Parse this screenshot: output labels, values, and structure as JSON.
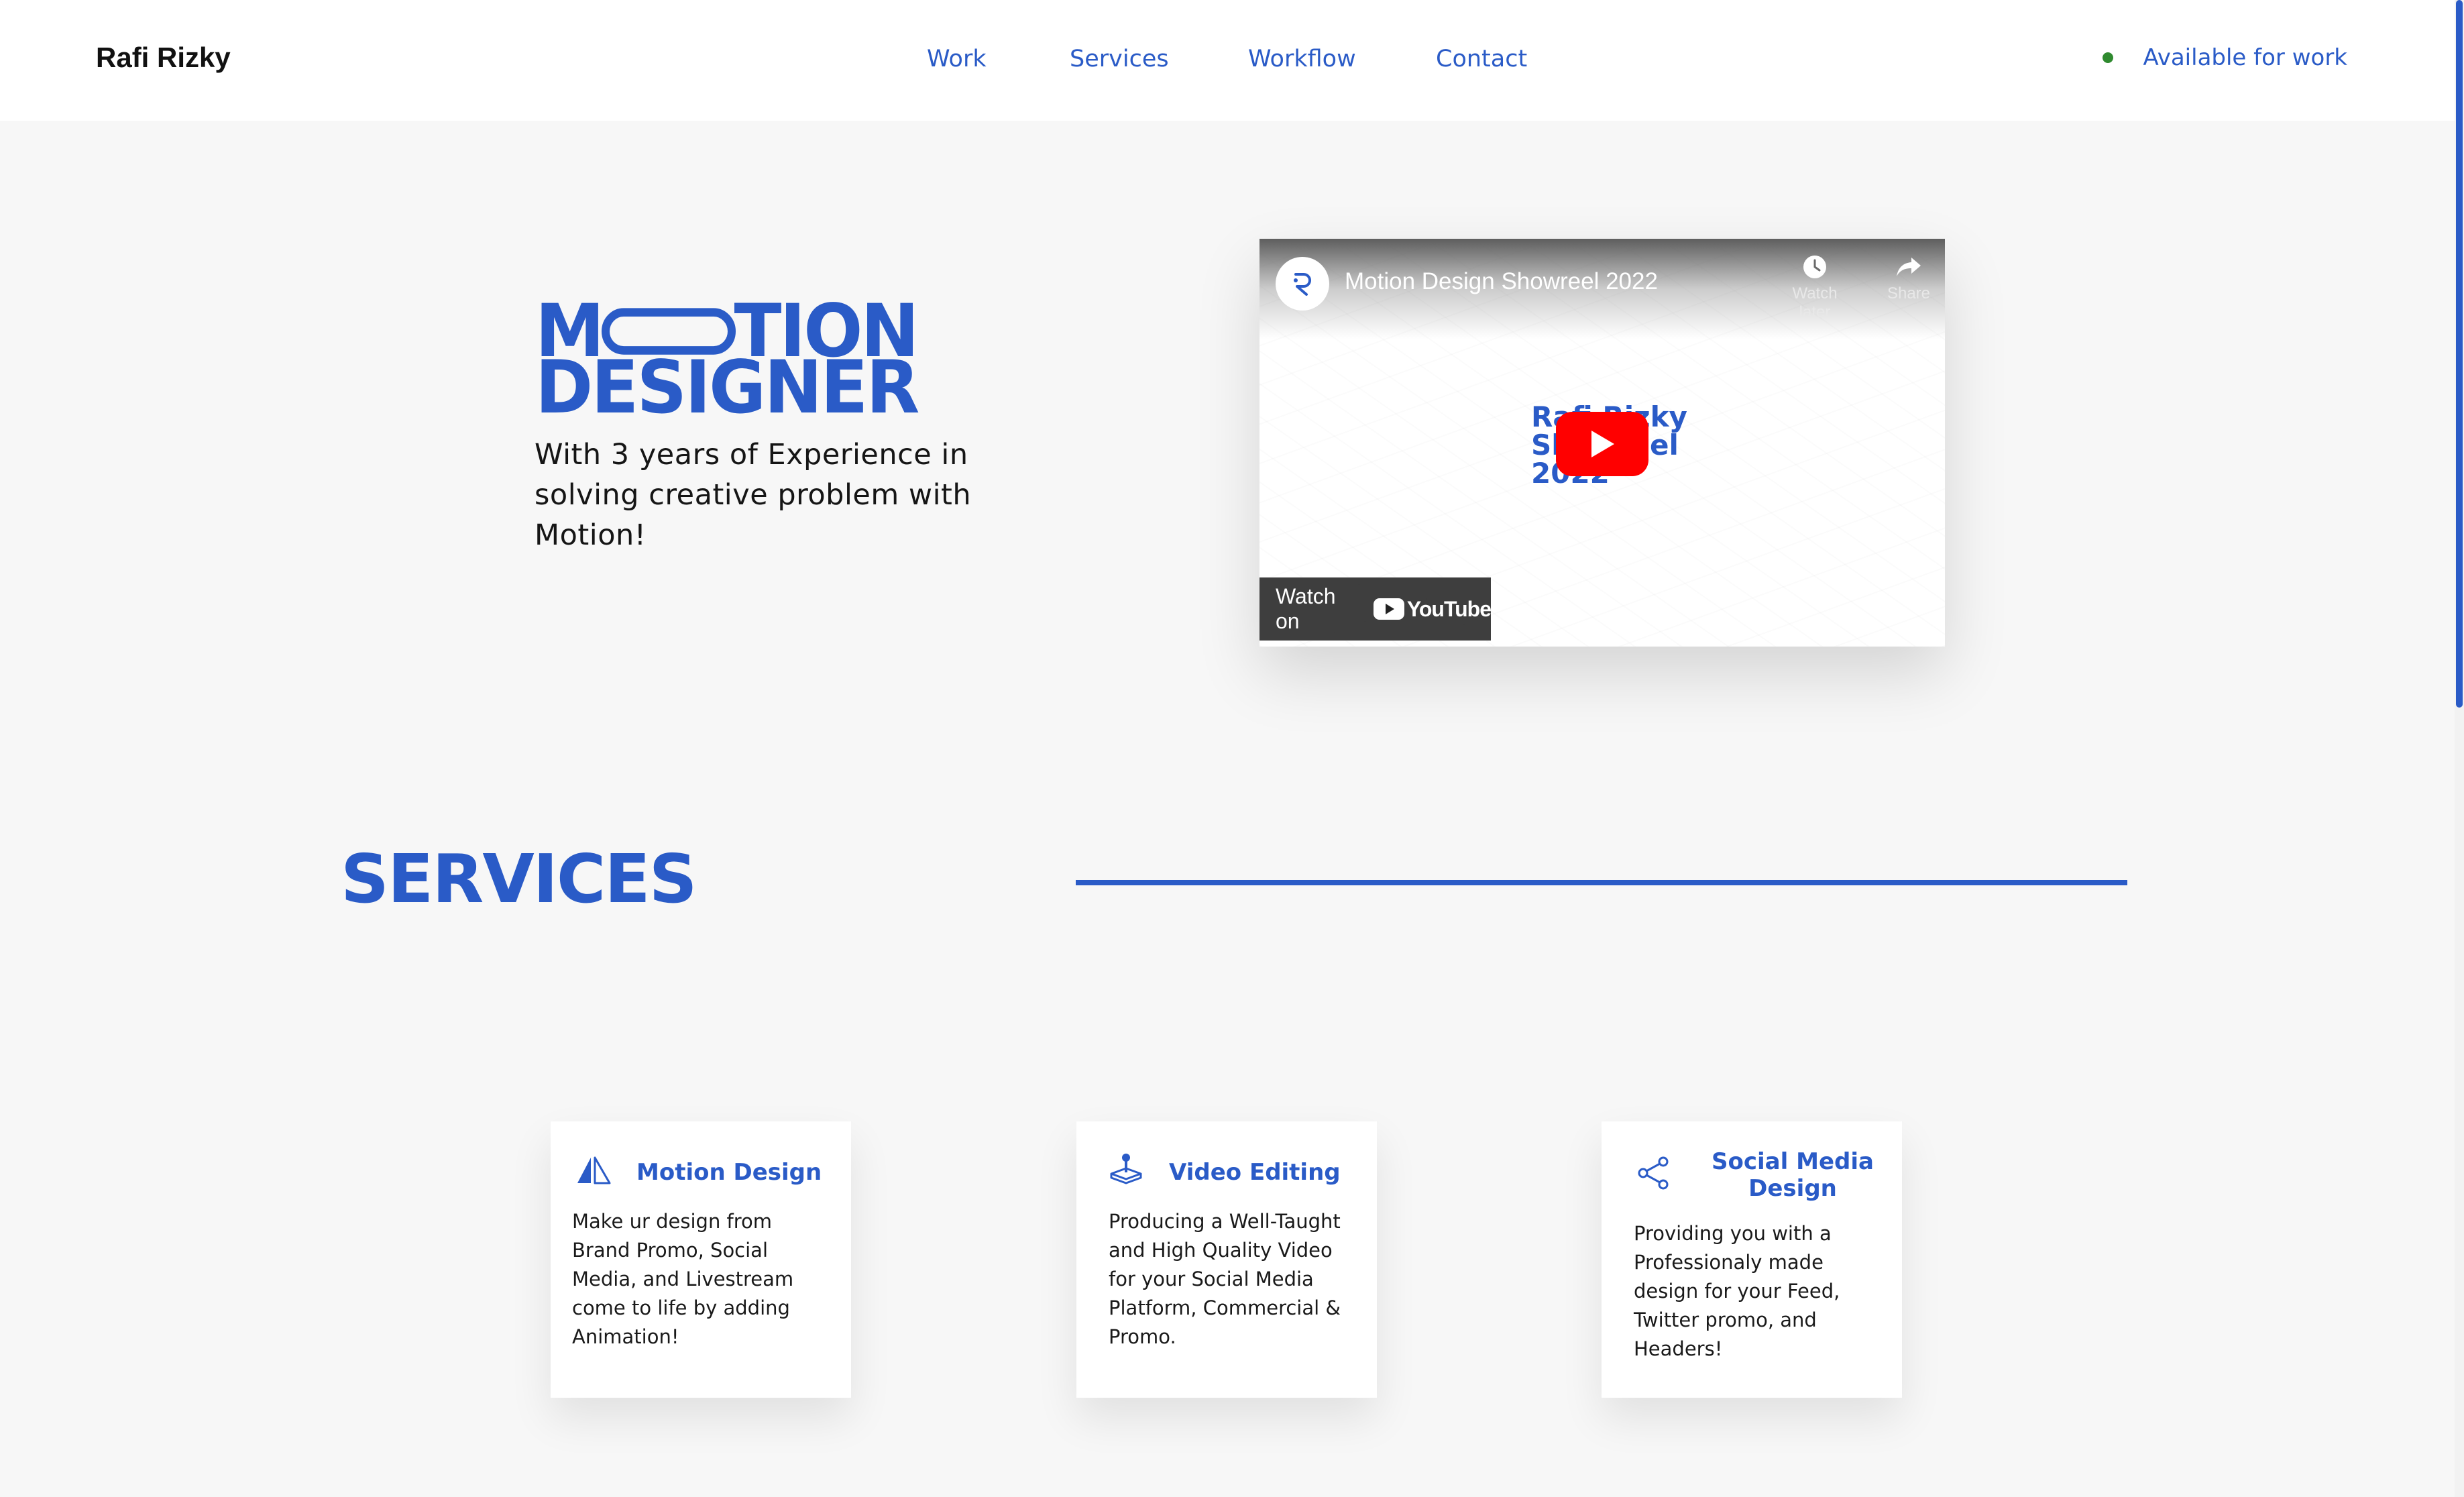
{
  "header": {
    "brand": "Rafi Rizky",
    "nav": [
      {
        "label": "Work"
      },
      {
        "label": "Services"
      },
      {
        "label": "Workflow"
      },
      {
        "label": "Contact"
      }
    ],
    "availability": "Available for work",
    "availability_color": "#2f8a2f"
  },
  "hero": {
    "title_line1_left": "M",
    "title_line1_right": "TION",
    "title_line2": "DESIGNER",
    "subtitle": "With 3 years of Experience in solving creative problem with Motion!"
  },
  "video": {
    "title": "Motion Design Showreel 2022",
    "watch_later": "Watch later",
    "share": "Share",
    "thumbnail_text": [
      "Rafi Rizky",
      "Showreel",
      "2022"
    ],
    "watch_on": "Watch on",
    "youtube": "YouTube"
  },
  "services": {
    "heading": "SERVICES",
    "cards": [
      {
        "icon": "sailboat-icon",
        "title": "Motion Design",
        "description": "Make ur design from Brand Promo, Social Media, and Livestream come to life by adding Animation!"
      },
      {
        "icon": "joystick-icon",
        "title": "Video Editing",
        "description": "Producing a Well-Taught and High Quality Video for your Social Media Platform, Commercial & Promo."
      },
      {
        "icon": "share-icon",
        "title": "Social Media Design",
        "description": "Providing you with a Professionaly made design for your Feed, Twitter promo, and Headers!"
      }
    ]
  },
  "theme": {
    "accent": "#2a5bc7",
    "background": "#f7f7f7"
  }
}
